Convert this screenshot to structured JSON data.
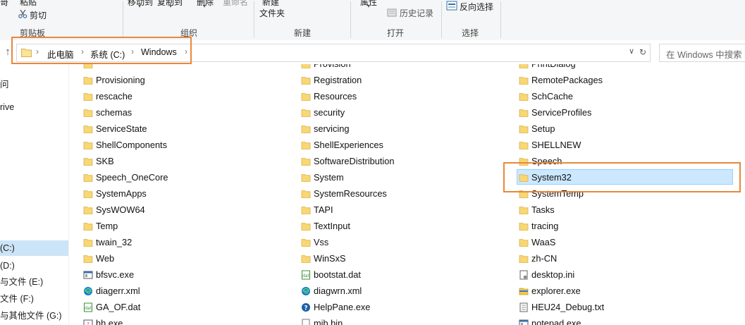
{
  "ribbon": {
    "paste_label": "粘贴",
    "cut_label": "剪切",
    "clipboard_group": "剪贴板",
    "move_to": "移动到",
    "copy_to": "复制到",
    "delete": "删除",
    "rename": "重命名",
    "organize_group": "组织",
    "new_folder_line1": "新建",
    "new_folder_line2": "文件夹",
    "new_group": "新建",
    "properties": "属性",
    "history": "历史记录",
    "open_group": "打开",
    "invert_selection": "反向选择",
    "select_group": "选择"
  },
  "address": {
    "crumbs": [
      "此电脑",
      "系统 (C:)",
      "Windows"
    ],
    "search_placeholder": "在 Windows 中搜索"
  },
  "nav": {
    "items": [
      {
        "label": "问"
      },
      {
        "label": "rive"
      },
      {
        "label": "(C:)"
      },
      {
        "label": "(D:)"
      },
      {
        "label": "与文件 (E:)"
      },
      {
        "label": "文件 (F:)"
      },
      {
        "label": "与其他文件 (G:)"
      }
    ]
  },
  "files": {
    "col1": [
      "",
      "Provisioning",
      "rescache",
      "schemas",
      "ServiceState",
      "ShellComponents",
      "SKB",
      "Speech_OneCore",
      "SystemApps",
      "SysWOW64",
      "Temp",
      "twain_32",
      "Web",
      "bfsvc.exe",
      "diagerr.xml",
      "GA_OF.dat",
      "hh.exe"
    ],
    "col2": [
      "Provision",
      "Registration",
      "Resources",
      "security",
      "servicing",
      "ShellExperiences",
      "SoftwareDistribution",
      "System",
      "SystemResources",
      "TAPI",
      "TextInput",
      "Vss",
      "WinSxS",
      "bootstat.dat",
      "diagwrn.xml",
      "HelpPane.exe",
      "mib.bin"
    ],
    "col3": [
      "PrintDialog",
      "RemotePackages",
      "SchCache",
      "ServiceProfiles",
      "Setup",
      "SHELLNEW",
      "Speech",
      "System32",
      "SystemTemp",
      "Tasks",
      "tracing",
      "WaaS",
      "zh-CN",
      "desktop.ini",
      "explorer.exe",
      "HEU24_Debug.txt",
      "notepad.exe"
    ]
  },
  "selected_item": "System32",
  "colors": {
    "accent_orange": "#e8883a",
    "selection_bg": "#cce8ff",
    "folder": "#f8d775"
  }
}
